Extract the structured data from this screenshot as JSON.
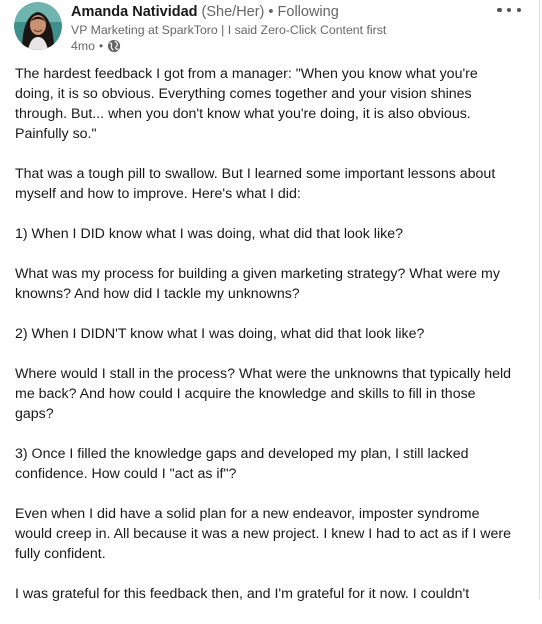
{
  "post": {
    "author": {
      "name": "Amanda Natividad",
      "pronouns": "(She/Her)",
      "separator": "•",
      "follow_status": "Following",
      "headline": "VP Marketing at SparkToro | I said Zero-Click Content first",
      "time_ago": "4mo",
      "meta_separator": "•",
      "visibility_icon": "globe-icon"
    },
    "more_icon": "more-horizontal-icon",
    "paragraphs": [
      "The hardest feedback I got from a manager: \"When you know what you're doing, it is so obvious. Everything comes together and your vision shines through. But... when you don't know what you're doing, it is also obvious. Painfully so.\"",
      "That was a tough pill to swallow. But I learned some important lessons about myself and how to improve. Here's what I did:",
      "1) When I DID know what I was doing, what did that look like?",
      "What was my process for building a given marketing strategy? What were my knowns? And how did I tackle my unknowns?",
      "2) When I DIDN'T know what I was doing, what did that look like?",
      "Where would I stall in the process? What were the unknowns that typically held me back? And how could I acquire the knowledge and skills to fill in those gaps?",
      "3) Once I filled the knowledge gaps and developed my plan, I still lacked confidence. How could I \"act as if\"?",
      "Even when I did have a solid plan for a new endeavor, imposter syndrome would creep in. All because it was a new project. I knew I had to act as if I were fully confident.",
      "I was grateful for this feedback then, and I'm grateful for it now. I couldn't"
    ]
  }
}
